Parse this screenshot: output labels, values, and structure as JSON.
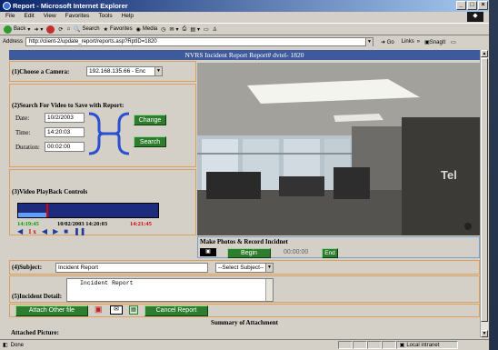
{
  "window": {
    "title": "Report - Microsoft Internet Explorer",
    "menu": [
      "File",
      "Edit",
      "View",
      "Favorites",
      "Tools",
      "Help"
    ],
    "toolbar": {
      "back": "Back",
      "search": "Search",
      "favorites": "Favorites",
      "media": "Media"
    },
    "address": {
      "label": "Address",
      "url": "http://client-2/update_report/reports.asp?RptID=1820",
      "go": "Go",
      "links": "Links",
      "snagit": "SnagIt"
    },
    "status": {
      "text": "Done",
      "zone": "Local intranet"
    }
  },
  "report": {
    "header": "NVRS Incident Report     Report# dvtel- 1820",
    "camera": {
      "label": "(1)Choose a Camera:",
      "value": "192.168.135.66 - Enc"
    },
    "search": {
      "title": "(2)Search For Video to Save with Report:",
      "date_label": "Date:",
      "date": "10/2/2003",
      "time_label": "Time:",
      "time": "14:20:03",
      "duration_label": "Duration:",
      "duration": "00:02:00",
      "change": "Change",
      "search": "Search"
    },
    "playback": {
      "title": "(3)Video PlayBack Controls",
      "start": "14:19:45",
      "current": "10/02/2003 14:20:03",
      "end": "14:21:45",
      "speed": "1 x",
      "position": 0.2
    },
    "photos": {
      "title": "Make Photos & Record Incidnet",
      "begin": "Begin",
      "timer": "00:00:00",
      "end": "End"
    },
    "subject": {
      "label": "(4)Subject:",
      "value": "Incident Report",
      "select": "--Select Subject--"
    },
    "detail": {
      "label": "(5)Incident Detail:",
      "value": "Incident Report"
    },
    "buttons": {
      "attach": "Attach Other file",
      "cancel": "Cancel Report"
    },
    "summary": {
      "title": "Summary of Attachment",
      "attached": "Attached Picture:"
    }
  },
  "colors": {
    "header": "#3d5a9c",
    "button": "#2e7d2e",
    "border": "#d9a060",
    "timestamp_red": "#d00000",
    "timestamp_green": "#00a000"
  }
}
